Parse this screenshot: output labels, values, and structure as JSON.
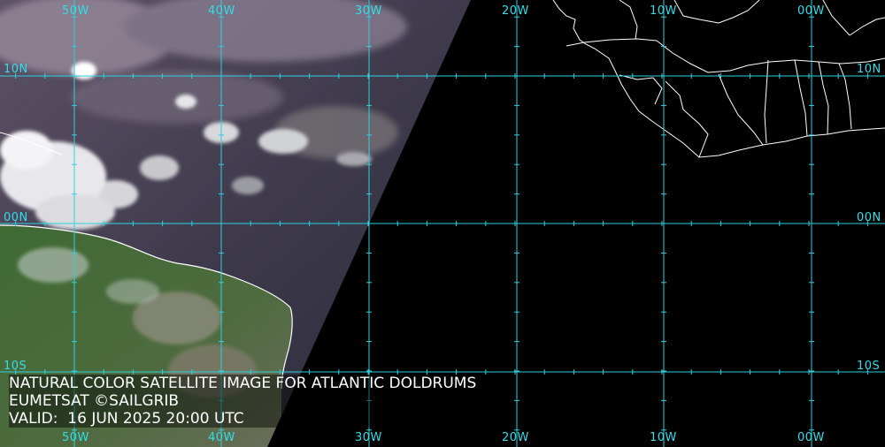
{
  "colors": {
    "grid": "#2fd0e0",
    "label": "#33dde8",
    "coastline": "#ffffff",
    "caption": "#ffffff",
    "night": "#000000"
  },
  "map": {
    "longitude_labels_top": [
      "50W",
      "40W",
      "30W",
      "20W",
      "10W",
      "00W"
    ],
    "longitude_labels_bottom": [
      "50W",
      "40W",
      "30W",
      "20W",
      "10W",
      "00W"
    ],
    "latitude_labels_left": [
      "10N",
      "00N",
      "10S"
    ],
    "latitude_labels_right": [
      "10N",
      "00N",
      "10S"
    ]
  },
  "caption": {
    "line1": "NATURAL COLOR SATELLITE IMAGE FOR ATLANTIC DOLDRUMS",
    "line2": "EUMETSAT ©SAILGRIB",
    "line3": "VALID:  16 JUN 2025 20:00 UTC"
  }
}
